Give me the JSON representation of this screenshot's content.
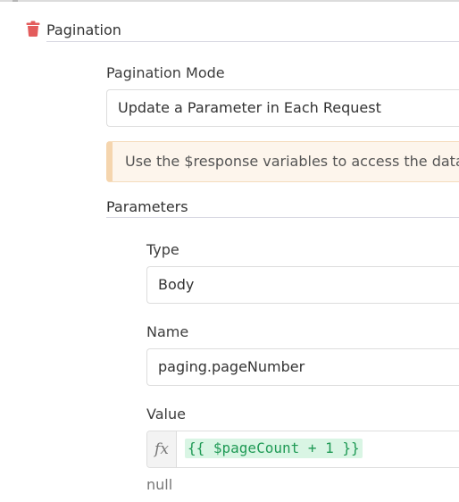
{
  "section": {
    "title": "Pagination",
    "delete_icon": "trash-icon",
    "delete_icon_color": "#e35c5c"
  },
  "pagination_mode": {
    "label": "Pagination Mode",
    "value": "Update a Parameter in Each Request"
  },
  "notice": {
    "text": "Use the $response variables to access the data o"
  },
  "parameters": {
    "title": "Parameters",
    "type": {
      "label": "Type",
      "value": "Body"
    },
    "name": {
      "label": "Name",
      "value": "paging.pageNumber"
    },
    "value": {
      "label": "Value",
      "expression_icon": "fx-icon",
      "expression": "{{ $pageCount + 1 }}",
      "result": "null"
    }
  },
  "colors": {
    "expression_text": "#1f9a55",
    "expression_bg": "#d9f5e4",
    "notice_bg": "#fdf5ec",
    "notice_accent": "#f5d5ae"
  }
}
